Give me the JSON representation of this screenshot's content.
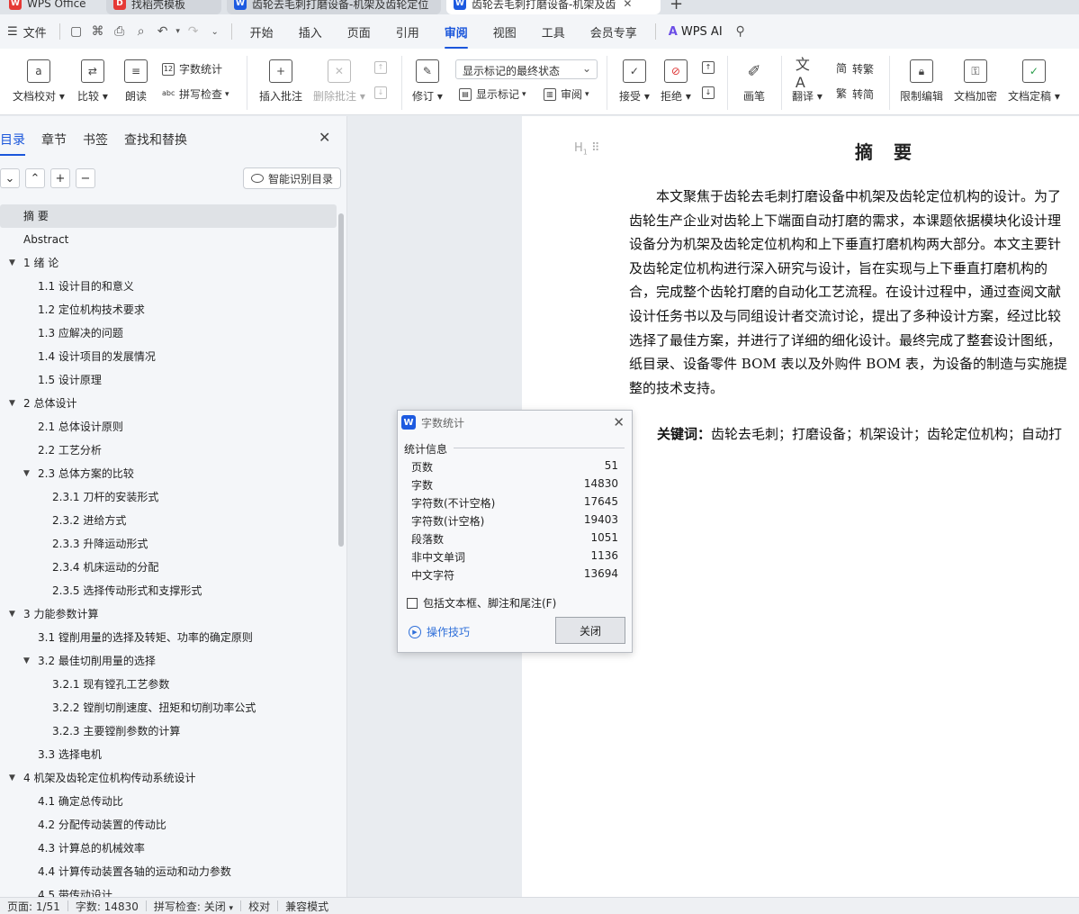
{
  "tabs": [
    {
      "label": "WPS Office",
      "icon": "wps-logo-icon"
    },
    {
      "label": "找稻壳模板",
      "icon": "docer-icon"
    },
    {
      "label": "齿轮去毛刺打磨设备-机架及齿轮定位",
      "icon": "word-doc-icon"
    },
    {
      "label": "齿轮去毛刺打磨设备-机架及齿",
      "icon": "word-doc-icon",
      "active": true
    }
  ],
  "menubar": {
    "file_label": "文件",
    "items": [
      "开始",
      "插入",
      "页面",
      "引用",
      "审阅",
      "视图",
      "工具",
      "会员专享"
    ],
    "active": "审阅",
    "ai_label": "WPS AI"
  },
  "ribbon": {
    "proofread": "文档校对",
    "compare": "比较",
    "read_aloud": "朗读",
    "word_count": "字数统计",
    "spell_check": "拼写检查",
    "insert_comment": "插入批注",
    "delete_comment": "删除批注",
    "revise": "修订",
    "markup_state": "显示标记的最终状态",
    "show_markup": "显示标记",
    "review": "审阅",
    "accept": "接受",
    "reject": "拒绝",
    "pen": "画笔",
    "translate": "翻译",
    "to_traditional": "转繁",
    "to_simplified": "转简",
    "restrict_edit": "限制编辑",
    "encrypt": "文档加密",
    "finalize": "文档定稿"
  },
  "nav": {
    "tabs": [
      "目录",
      "章节",
      "书签",
      "查找和替换"
    ],
    "active_tab": "目录",
    "smart_button": "智能识别目录",
    "toc": [
      {
        "text": "摘  要",
        "level": 0,
        "selected": true
      },
      {
        "text": "Abstract",
        "level": 0
      },
      {
        "text": "1    绪  论",
        "level": 0,
        "expanded": true
      },
      {
        "text": "1.1  设计目的和意义",
        "level": 1
      },
      {
        "text": "1.2  定位机构技术要求",
        "level": 1
      },
      {
        "text": "1.3  应解决的问题",
        "level": 1
      },
      {
        "text": "1.4  设计项目的发展情况",
        "level": 1
      },
      {
        "text": "1.5  设计原理",
        "level": 1
      },
      {
        "text": "2    总体设计",
        "level": 0,
        "expanded": true
      },
      {
        "text": "2.1  总体设计原则",
        "level": 1
      },
      {
        "text": "2.2  工艺分析",
        "level": 1
      },
      {
        "text": "2.3  总体方案的比较",
        "level": 1,
        "expanded": true
      },
      {
        "text": "2.3.1  刀杆的安装形式",
        "level": 2
      },
      {
        "text": "2.3.2  进给方式",
        "level": 2
      },
      {
        "text": "2.3.3  升降运动形式",
        "level": 2
      },
      {
        "text": "2.3.4  机床运动的分配",
        "level": 2
      },
      {
        "text": "2.3.5  选择传动形式和支撑形式",
        "level": 2
      },
      {
        "text": "3    力能参数计算",
        "level": 0,
        "expanded": true
      },
      {
        "text": "3.1  镗削用量的选择及转矩、功率的确定原则",
        "level": 1
      },
      {
        "text": "3.2  最佳切削用量的选择",
        "level": 1,
        "expanded": true
      },
      {
        "text": "3.2.1  现有镗孔工艺参数",
        "level": 2
      },
      {
        "text": "3.2.2  镗削切削速度、扭矩和切削功率公式",
        "level": 2
      },
      {
        "text": "3.2.3  主要镗削参数的计算",
        "level": 2
      },
      {
        "text": "3.3  选择电机",
        "level": 1
      },
      {
        "text": "4    机架及齿轮定位机构传动系统设计",
        "level": 0,
        "expanded": true
      },
      {
        "text": "4.1  确定总传动比",
        "level": 1
      },
      {
        "text": "4.2  分配传动装置的传动比",
        "level": 1
      },
      {
        "text": "4.3  计算总的机械效率",
        "level": 1
      },
      {
        "text": "4.4  计算传动装置各轴的运动和动力参数",
        "level": 1
      },
      {
        "text": "4.5  带传动设计",
        "level": 1
      }
    ]
  },
  "doc": {
    "heading_marker": "H",
    "title": "摘  要",
    "lines": [
      "本文聚焦于齿轮去毛刺打磨设备中机架及齿轮定位机构的设计。为了",
      "齿轮生产企业对齿轮上下端面自动打磨的需求，本课题依据模块化设计理",
      "设备分为机架及齿轮定位机构和上下垂直打磨机构两大部分。本文主要针",
      "及齿轮定位机构进行深入研究与设计，旨在实现与上下垂直打磨机构的",
      "合，完成整个齿轮打磨的自动化工艺流程。在设计过程中，通过查阅文献",
      "设计任务书以及与同组设计者交流讨论，提出了多种设计方案，经过比较",
      "选择了最佳方案，并进行了详细的细化设计。最终完成了整套设计图纸，",
      "纸目录、设备零件 BOM 表以及外购件 BOM 表，为设备的制造与实施提",
      "整的技术支持。"
    ],
    "keywords_label": "关键词：",
    "keywords": "齿轮去毛刺；打磨设备；机架设计；齿轮定位机构；自动打"
  },
  "dialog": {
    "title": "字数统计",
    "section": "统计信息",
    "stats": [
      {
        "label": "页数",
        "value": "51"
      },
      {
        "label": "字数",
        "value": "14830"
      },
      {
        "label": "字符数(不计空格)",
        "value": "17645"
      },
      {
        "label": "字符数(计空格)",
        "value": "19403"
      },
      {
        "label": "段落数",
        "value": "1051"
      },
      {
        "label": "非中文单词",
        "value": "1136"
      },
      {
        "label": "中文字符",
        "value": "13694"
      }
    ],
    "checkbox": "包括文本框、脚注和尾注(F)",
    "checked": false,
    "tips": "操作技巧",
    "close": "关闭"
  },
  "status": {
    "page": "页面: 1/51",
    "words": "字数: 14830",
    "spell": "拼写检查: 关闭",
    "proof": "校对",
    "compat": "兼容模式"
  },
  "colors": {
    "accent": "#1a56db",
    "wps_red": "#e53935",
    "word_blue": "#1d5ae0"
  }
}
